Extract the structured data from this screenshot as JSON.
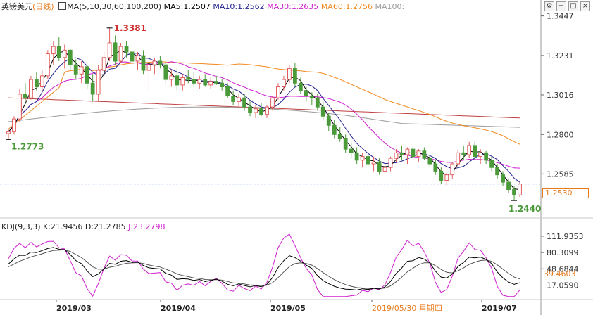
{
  "header": {
    "symbol": "英镑美元",
    "period": "(日线)",
    "ma_label": "MA(5,10,30,60,100,200)",
    "ma5": "MA5:1.2507",
    "ma10": "MA10:1.2562",
    "ma30": "MA30:1.2635",
    "ma60": "MA60:1.2756",
    "ma100": "MA100:",
    "icons": [
      "settings-icon",
      "minimize-icon",
      "maximize-icon",
      "close-icon"
    ]
  },
  "kdj_header": {
    "label": "KDJ(9,3,3)",
    "k": "K:21.9456",
    "d": "D:21.2785",
    "j": "J:23.2798"
  },
  "colors": {
    "up": "#e25c5c",
    "down": "#4a9a3a",
    "ma5": "#000000",
    "ma10": "#1f1f8f",
    "ma30": "#d020d0",
    "ma60": "#f08a20",
    "ma100": "#9a9a9a",
    "ma200": "#c04040",
    "kdj_k": "#000000",
    "kdj_d": "#555555",
    "kdj_j": "#d020d0",
    "dashed": "#3b7dd8",
    "high_label": "#d03030",
    "low_label": "#4a9a3a"
  },
  "chart_data": [
    {
      "type": "candlestick",
      "title": "英镑美元(日线)",
      "y_ticks": [
        "1.3447",
        "1.3231",
        "1.3016",
        "1.2800",
        "1.2585"
      ],
      "ylim": [
        1.236,
        1.348
      ],
      "current_price": "1.2530",
      "annotations": {
        "high": "1.3381",
        "low": "1.2773",
        "recent_low": "1.2440"
      },
      "x_labels": [
        "2019/03",
        "2019/04",
        "2019/05",
        "2019/05/30 星期四",
        "2019/07"
      ],
      "grid": false,
      "candles": [
        [
          1.2805,
          1.283,
          1.2773,
          1.2815
        ],
        [
          1.2815,
          1.29,
          1.28,
          1.2885
        ],
        [
          1.2885,
          1.305,
          1.287,
          1.302
        ],
        [
          1.302,
          1.308,
          1.298,
          1.3
        ],
        [
          1.3,
          1.312,
          1.299,
          1.31
        ],
        [
          1.31,
          1.314,
          1.304,
          1.306
        ],
        [
          1.306,
          1.315,
          1.303,
          1.312
        ],
        [
          1.312,
          1.326,
          1.31,
          1.324
        ],
        [
          1.324,
          1.331,
          1.318,
          1.328
        ],
        [
          1.328,
          1.333,
          1.32,
          1.322
        ],
        [
          1.322,
          1.329,
          1.316,
          1.326
        ],
        [
          1.326,
          1.327,
          1.315,
          1.318
        ],
        [
          1.318,
          1.321,
          1.31,
          1.313
        ],
        [
          1.313,
          1.32,
          1.308,
          1.317
        ],
        [
          1.317,
          1.318,
          1.305,
          1.308
        ],
        [
          1.308,
          1.313,
          1.298,
          1.302
        ],
        [
          1.302,
          1.318,
          1.298,
          1.315
        ],
        [
          1.315,
          1.325,
          1.312,
          1.322
        ],
        [
          1.322,
          1.3381,
          1.32,
          1.33
        ],
        [
          1.33,
          1.334,
          1.318,
          1.32
        ],
        [
          1.32,
          1.33,
          1.319,
          1.328
        ],
        [
          1.328,
          1.331,
          1.322,
          1.325
        ],
        [
          1.325,
          1.329,
          1.318,
          1.32
        ],
        [
          1.32,
          1.325,
          1.315,
          1.323
        ],
        [
          1.323,
          1.326,
          1.313,
          1.315
        ],
        [
          1.315,
          1.32,
          1.304,
          1.318
        ],
        [
          1.318,
          1.322,
          1.313,
          1.32
        ],
        [
          1.32,
          1.323,
          1.316,
          1.318
        ],
        [
          1.318,
          1.32,
          1.307,
          1.31
        ],
        [
          1.31,
          1.315,
          1.306,
          1.312
        ],
        [
          1.312,
          1.316,
          1.304,
          1.307
        ],
        [
          1.307,
          1.313,
          1.304,
          1.311
        ],
        [
          1.311,
          1.315,
          1.308,
          1.31
        ],
        [
          1.31,
          1.314,
          1.306,
          1.308
        ],
        [
          1.308,
          1.312,
          1.305,
          1.31
        ],
        [
          1.31,
          1.313,
          1.306,
          1.307
        ],
        [
          1.307,
          1.311,
          1.305,
          1.309
        ],
        [
          1.309,
          1.312,
          1.307,
          1.308
        ],
        [
          1.308,
          1.31,
          1.304,
          1.306
        ],
        [
          1.306,
          1.308,
          1.3,
          1.301
        ],
        [
          1.301,
          1.304,
          1.296,
          1.298
        ],
        [
          1.298,
          1.302,
          1.295,
          1.3
        ],
        [
          1.3,
          1.302,
          1.293,
          1.295
        ],
        [
          1.295,
          1.298,
          1.29,
          1.292
        ],
        [
          1.292,
          1.296,
          1.289,
          1.294
        ],
        [
          1.294,
          1.297,
          1.29,
          1.291
        ],
        [
          1.291,
          1.296,
          1.289,
          1.295
        ],
        [
          1.295,
          1.301,
          1.293,
          1.3
        ],
        [
          1.3,
          1.308,
          1.299,
          1.306
        ],
        [
          1.306,
          1.312,
          1.304,
          1.31
        ],
        [
          1.31,
          1.318,
          1.308,
          1.316
        ],
        [
          1.316,
          1.319,
          1.306,
          1.308
        ],
        [
          1.308,
          1.311,
          1.302,
          1.304
        ],
        [
          1.304,
          1.306,
          1.298,
          1.301
        ],
        [
          1.301,
          1.303,
          1.296,
          1.3
        ],
        [
          1.3,
          1.302,
          1.293,
          1.295
        ],
        [
          1.295,
          1.298,
          1.288,
          1.29
        ],
        [
          1.29,
          1.292,
          1.282,
          1.285
        ],
        [
          1.285,
          1.288,
          1.278,
          1.28
        ],
        [
          1.28,
          1.284,
          1.276,
          1.278
        ],
        [
          1.278,
          1.28,
          1.27,
          1.272
        ],
        [
          1.272,
          1.276,
          1.267,
          1.27
        ],
        [
          1.27,
          1.273,
          1.264,
          1.266
        ],
        [
          1.266,
          1.27,
          1.262,
          1.268
        ],
        [
          1.268,
          1.27,
          1.262,
          1.264
        ],
        [
          1.264,
          1.268,
          1.26,
          1.265
        ],
        [
          1.265,
          1.267,
          1.258,
          1.26
        ],
        [
          1.26,
          1.264,
          1.256,
          1.262
        ],
        [
          1.262,
          1.268,
          1.26,
          1.267
        ],
        [
          1.267,
          1.272,
          1.265,
          1.27
        ],
        [
          1.27,
          1.274,
          1.266,
          1.269
        ],
        [
          1.269,
          1.273,
          1.264,
          1.272
        ],
        [
          1.272,
          1.274,
          1.267,
          1.268
        ],
        [
          1.268,
          1.272,
          1.265,
          1.271
        ],
        [
          1.271,
          1.273,
          1.266,
          1.267
        ],
        [
          1.267,
          1.269,
          1.262,
          1.264
        ],
        [
          1.264,
          1.266,
          1.258,
          1.26
        ],
        [
          1.26,
          1.262,
          1.253,
          1.255
        ],
        [
          1.255,
          1.259,
          1.252,
          1.258
        ],
        [
          1.258,
          1.265,
          1.256,
          1.264
        ],
        [
          1.264,
          1.272,
          1.262,
          1.27
        ],
        [
          1.27,
          1.274,
          1.266,
          1.269
        ],
        [
          1.269,
          1.276,
          1.267,
          1.274
        ],
        [
          1.274,
          1.276,
          1.266,
          1.268
        ],
        [
          1.268,
          1.272,
          1.264,
          1.27
        ],
        [
          1.27,
          1.271,
          1.264,
          1.266
        ],
        [
          1.266,
          1.268,
          1.26,
          1.262
        ],
        [
          1.262,
          1.264,
          1.256,
          1.258
        ],
        [
          1.258,
          1.26,
          1.252,
          1.254
        ],
        [
          1.254,
          1.256,
          1.248,
          1.25
        ],
        [
          1.25,
          1.252,
          1.244,
          1.247
        ],
        [
          1.247,
          1.254,
          1.246,
          1.253
        ]
      ],
      "ma_series": [
        {
          "name": "MA5",
          "color_key": "ma5",
          "kind": "ma",
          "period": 5
        },
        {
          "name": "MA10",
          "color_key": "ma10",
          "kind": "ma",
          "period": 10
        },
        {
          "name": "MA30",
          "color_key": "ma30",
          "kind": "ma",
          "period": 30
        },
        {
          "name": "MA60",
          "color_key": "ma60",
          "kind": "ma",
          "period": 60
        }
      ]
    },
    {
      "type": "line",
      "title": "KDJ(9,3,3)",
      "y_ticks": [
        "111.9353",
        "80.3099",
        "48.6844",
        "17.0590"
      ],
      "current_value": "39.4603",
      "ylim": [
        0,
        120
      ],
      "grid": false
    }
  ]
}
